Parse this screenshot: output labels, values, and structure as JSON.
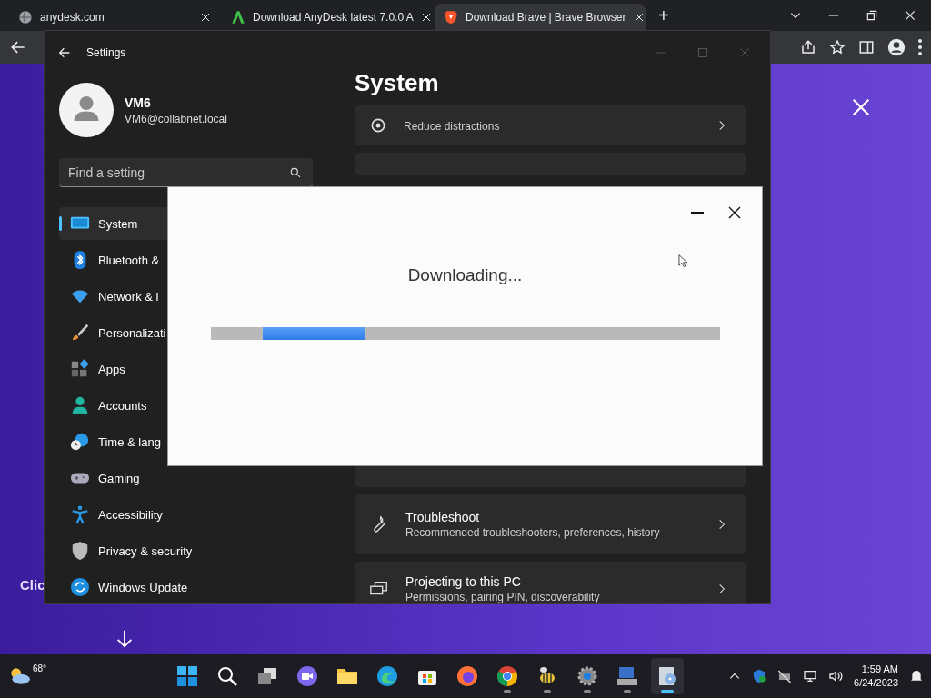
{
  "browser": {
    "tabs": [
      {
        "title": "anydesk.com",
        "selected": false
      },
      {
        "title": "Download AnyDesk latest 7.0.0 A",
        "selected": false
      },
      {
        "title": "Download Brave | Brave Browser",
        "selected": true
      }
    ],
    "new_tab": "+",
    "page": {
      "partial_text": "Clic"
    }
  },
  "settings": {
    "title": "Settings",
    "user": {
      "name": "VM6",
      "email": "VM6@collabnet.local"
    },
    "search": {
      "placeholder": "Find a setting"
    },
    "nav": [
      {
        "label": "System",
        "selected": true
      },
      {
        "label": "Bluetooth &",
        "selected": false
      },
      {
        "label": "Network & i",
        "selected": false
      },
      {
        "label": "Personalizati",
        "selected": false
      },
      {
        "label": "Apps",
        "selected": false
      },
      {
        "label": "Accounts",
        "selected": false
      },
      {
        "label": "Time & lang",
        "selected": false
      },
      {
        "label": "Gaming",
        "selected": false
      },
      {
        "label": "Accessibility",
        "selected": false
      },
      {
        "label": "Privacy & security",
        "selected": false
      },
      {
        "label": "Windows Update",
        "selected": false
      }
    ],
    "page_title": "System",
    "cards": [
      {
        "subtitle": "Reduce distractions"
      },
      {
        "title": "Troubleshoot",
        "subtitle": "Recommended troubleshooters, preferences, history"
      },
      {
        "title": "Projecting to this PC",
        "subtitle": "Permissions, pairing PIN, discoverability"
      }
    ]
  },
  "dialog": {
    "message": "Downloading...",
    "progress": {
      "level": 0.2
    }
  },
  "taskbar": {
    "weather": "68°",
    "apps": [
      {
        "running": false,
        "active": false
      },
      {
        "running": false,
        "active": false
      },
      {
        "running": false,
        "active": false
      },
      {
        "running": false,
        "active": false
      },
      {
        "running": false,
        "active": false
      },
      {
        "running": false,
        "active": false
      },
      {
        "running": false,
        "active": false
      },
      {
        "running": false,
        "active": false
      },
      {
        "running": true,
        "active": false
      },
      {
        "running": true,
        "active": false
      },
      {
        "running": true,
        "active": false
      },
      {
        "running": true,
        "active": false
      },
      {
        "running": true,
        "active": true
      }
    ],
    "time": "1:59 AM",
    "date": "6/24/2023"
  }
}
